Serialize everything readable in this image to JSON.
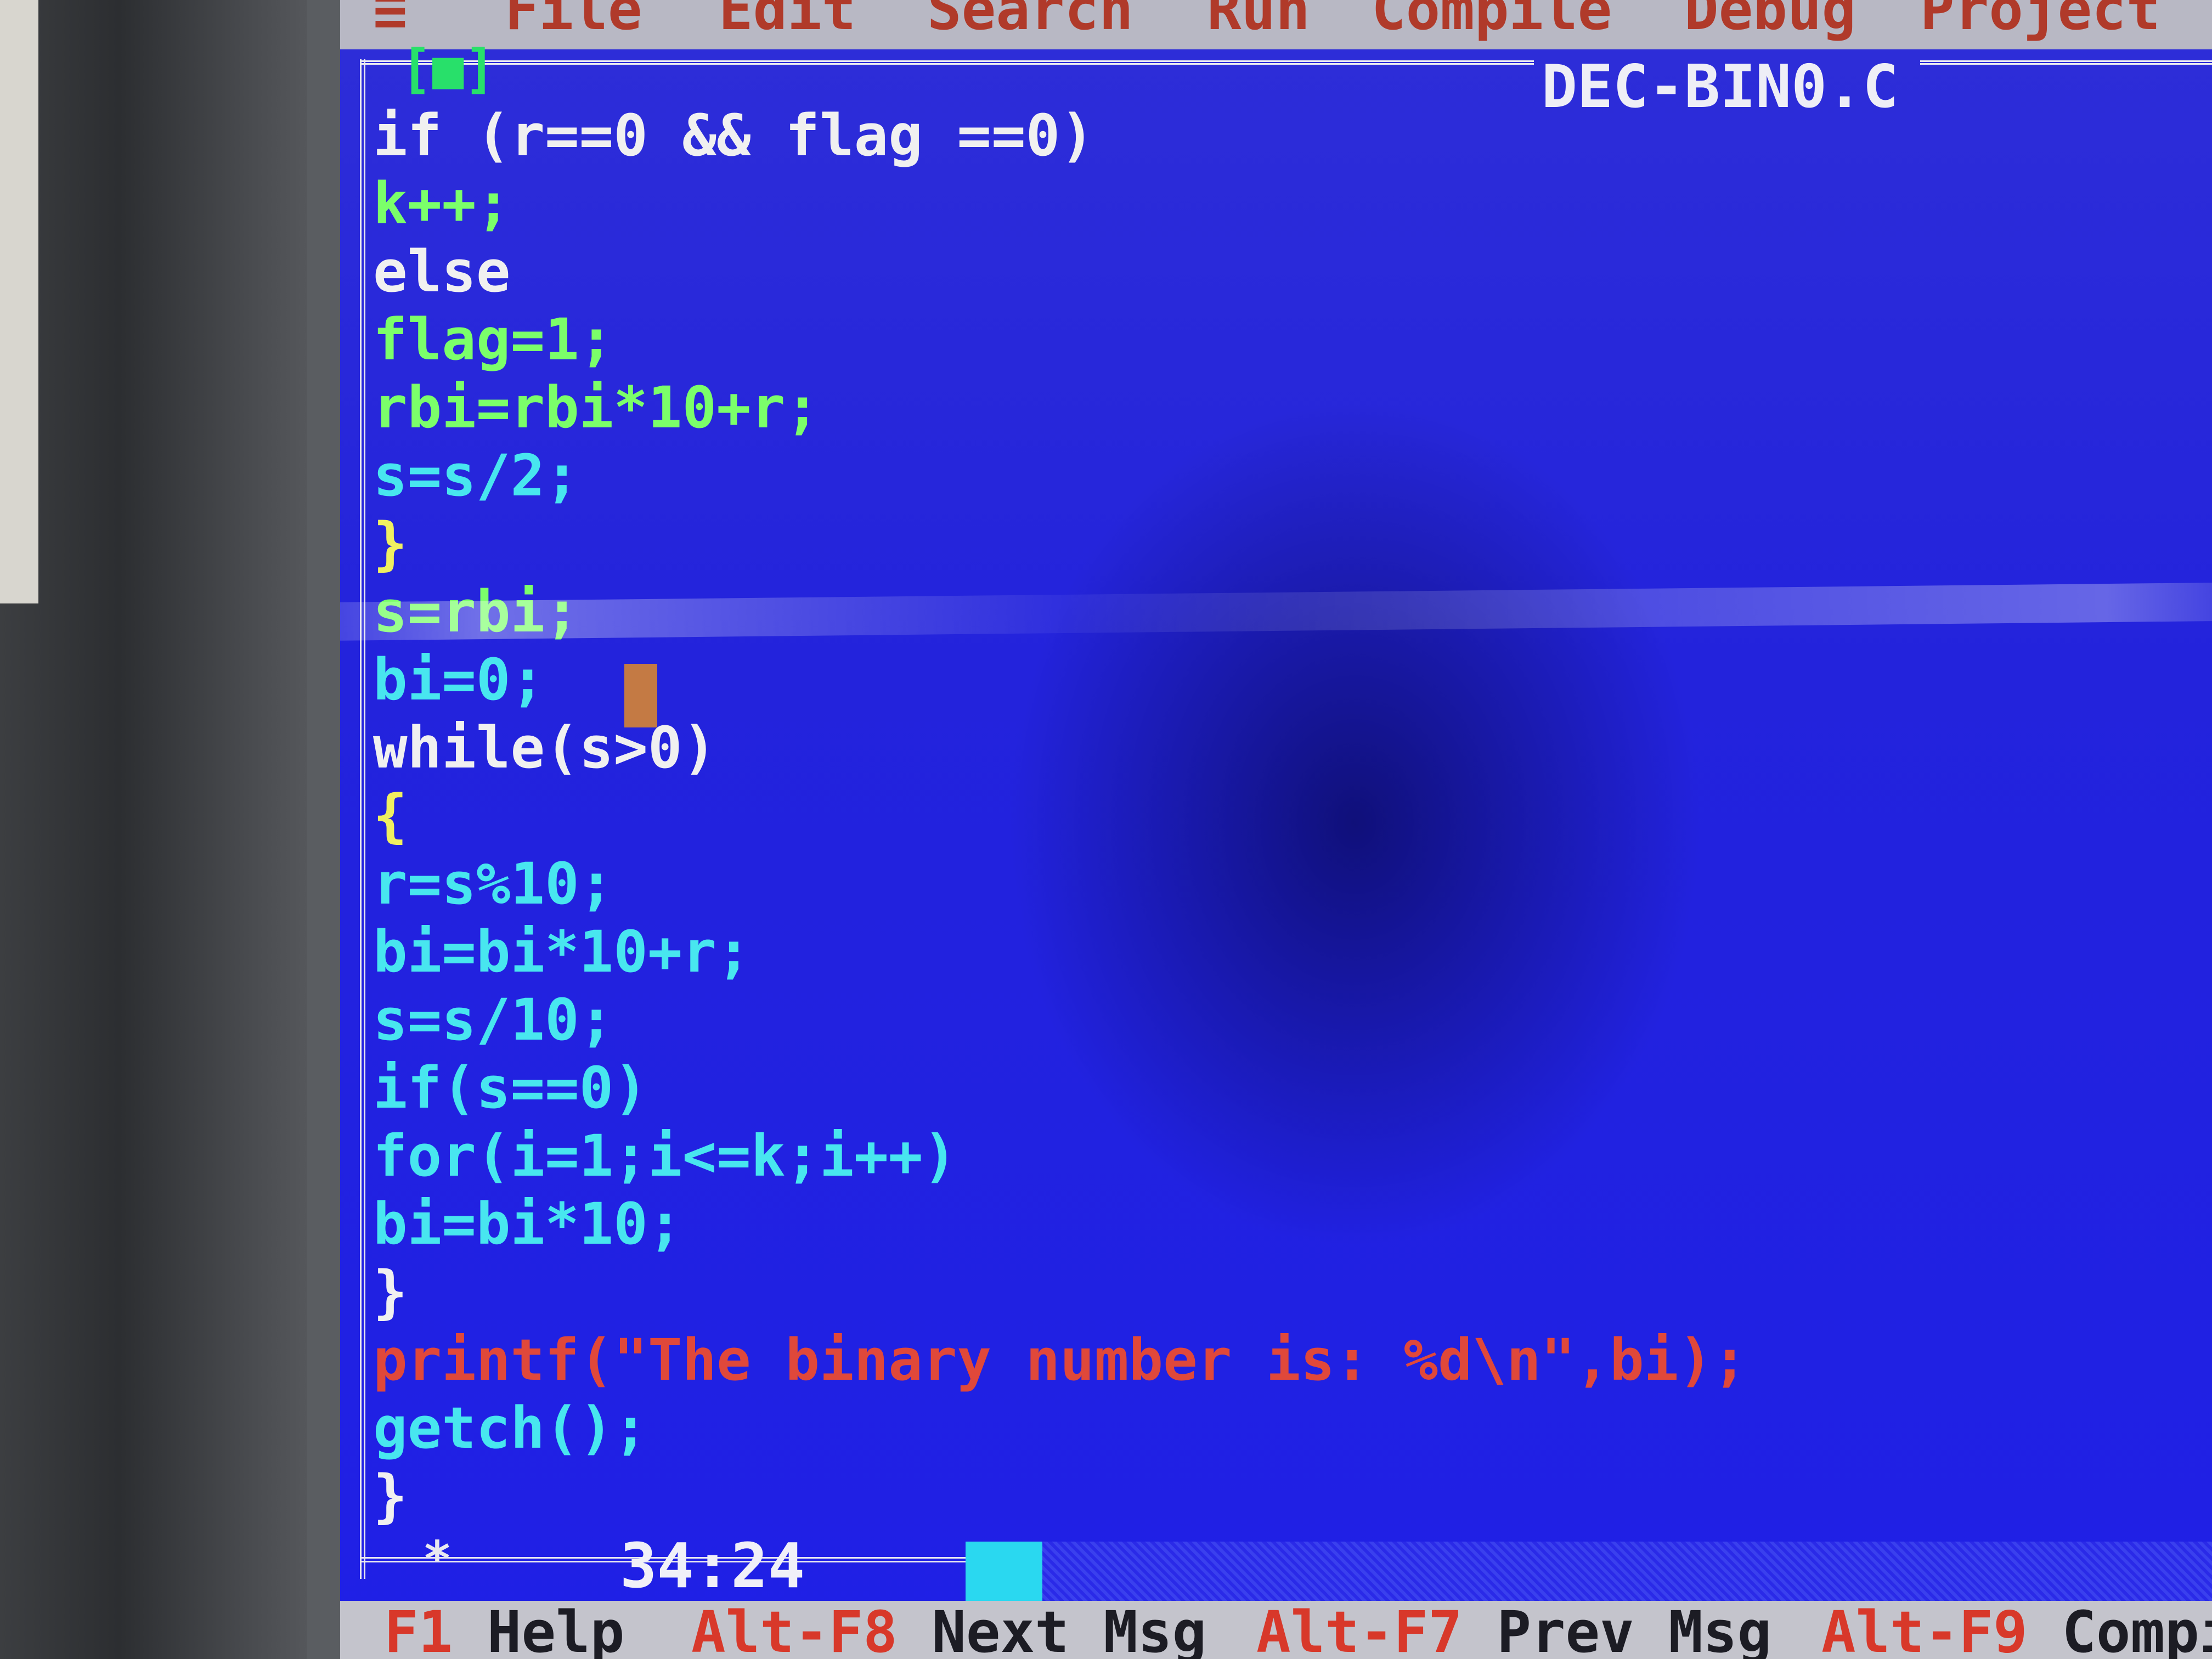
{
  "menu": {
    "system": "≡",
    "items": [
      "File",
      "Edit",
      "Search",
      "Run",
      "Compile",
      "Debug",
      "Project"
    ]
  },
  "window": {
    "close_box": "[■]",
    "filename": "DEC-BIN0.C",
    "cursor_position": "34:24"
  },
  "code": {
    "lines": [
      "if (r==0 && flag ==0)",
      "k++;",
      "else",
      "flag=1;",
      "rbi=rbi*10+r;",
      "s=s/2;",
      "}",
      "s=rbi;",
      "bi=0;",
      "while(s>0)",
      "{",
      "r=s%10;",
      "bi=bi*10+r;",
      "s=s/10;",
      "if(s==0)",
      "for(i=1;i<=k;i++)",
      "bi=bi*10;",
      "}",
      "printf(\"The binary number is: %d\\n\",bi);",
      "getch();",
      "}"
    ]
  },
  "status": {
    "items": [
      {
        "key": "F1",
        "label": "Help"
      },
      {
        "key": "Alt-F8",
        "label": "Next Msg"
      },
      {
        "key": "Alt-F7",
        "label": "Prev Msg"
      },
      {
        "key": "Alt-F9",
        "label": "Compi"
      }
    ]
  },
  "colors": {
    "editor_background": "#2323dc",
    "menubar": "#b8b8c4",
    "menu_text": "#b03a2a",
    "code_text": "#48e6ef",
    "string_text": "#e0483a",
    "cursor": "#c47a44",
    "statusbar": "#c4c4cc"
  }
}
